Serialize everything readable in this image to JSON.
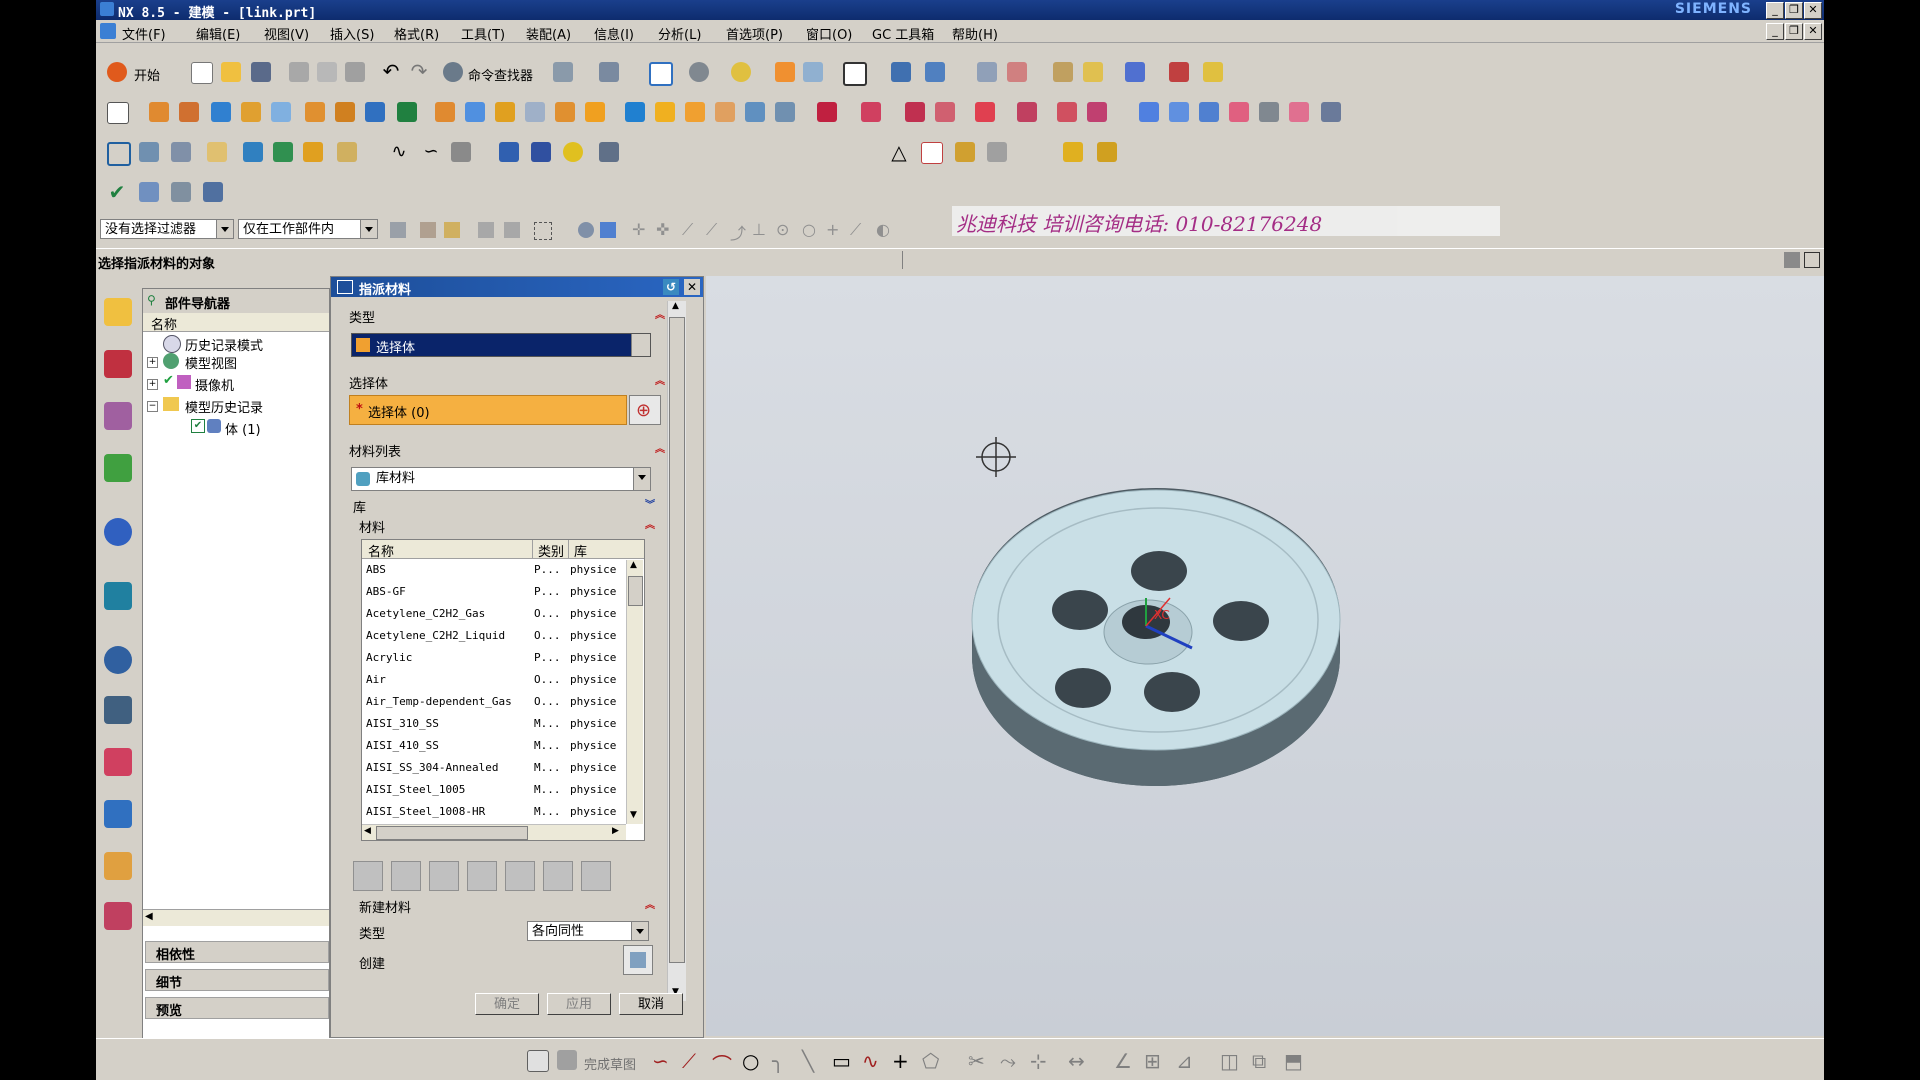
{
  "title_bar": {
    "title": "NX 8.5 - 建模 - [link.prt]",
    "brand": "SIEMENS"
  },
  "menu": [
    "文件(F)",
    "编辑(E)",
    "视图(V)",
    "插入(S)",
    "格式(R)",
    "工具(T)",
    "装配(A)",
    "信息(I)",
    "分析(L)",
    "首选项(P)",
    "窗口(O)",
    "GC 工具箱",
    "帮助(H)"
  ],
  "toolbar": {
    "start_label": "开始",
    "command_finder_label": "命令查找器"
  },
  "selection_bar": {
    "filter": "没有选择过滤器",
    "scope": "仅在工作部件内"
  },
  "watermark": "兆迪科技 培训咨询电话: 010-82176248",
  "cue_line": "选择指派材料的对象",
  "navigator": {
    "title": "部件导航器",
    "column": "名称",
    "items": [
      "历史记录模式",
      "模型视图",
      "摄像机",
      "模型历史记录",
      "体 (1)"
    ],
    "panels": [
      "相依性",
      "细节",
      "预览"
    ]
  },
  "dialog": {
    "title": "指派材料",
    "type_section": "类型",
    "type_value": "选择体",
    "select_section": "选择体",
    "select_value": "选择体 (0)",
    "material_list_section": "材料列表",
    "material_list_value": "库材料",
    "library_section": "库",
    "materials_section": "材料",
    "columns": [
      "名称",
      "类别",
      "库"
    ],
    "materials": [
      {
        "name": "ABS",
        "cat": "P...",
        "lib": "physice"
      },
      {
        "name": "ABS-GF",
        "cat": "P...",
        "lib": "physice"
      },
      {
        "name": "Acetylene_C2H2_Gas",
        "cat": "O...",
        "lib": "physice"
      },
      {
        "name": "Acetylene_C2H2_Liquid",
        "cat": "O...",
        "lib": "physice"
      },
      {
        "name": "Acrylic",
        "cat": "P...",
        "lib": "physice"
      },
      {
        "name": "Air",
        "cat": "O...",
        "lib": "physice"
      },
      {
        "name": "Air_Temp-dependent_Gas",
        "cat": "O...",
        "lib": "physice"
      },
      {
        "name": "AISI_310_SS",
        "cat": "M...",
        "lib": "physice"
      },
      {
        "name": "AISI_410_SS",
        "cat": "M...",
        "lib": "physice"
      },
      {
        "name": "AISI_SS_304-Annealed",
        "cat": "M...",
        "lib": "physice"
      },
      {
        "name": "AISI_Steel_1005",
        "cat": "M...",
        "lib": "physice"
      },
      {
        "name": "AISI_Steel_1008-HR",
        "cat": "M...",
        "lib": "physice"
      }
    ],
    "new_material_section": "新建材料",
    "new_type_label": "类型",
    "new_type_value": "各向同性",
    "create_label": "创建",
    "ok": "确定",
    "apply": "应用",
    "cancel": "取消"
  },
  "bottom_toolbar": {
    "finish_sketch": "完成草图"
  },
  "model_label": "XC",
  "colors": {
    "accent": "#0a246a",
    "select_highlight": "#f5b041",
    "part": "#c8dde4"
  }
}
